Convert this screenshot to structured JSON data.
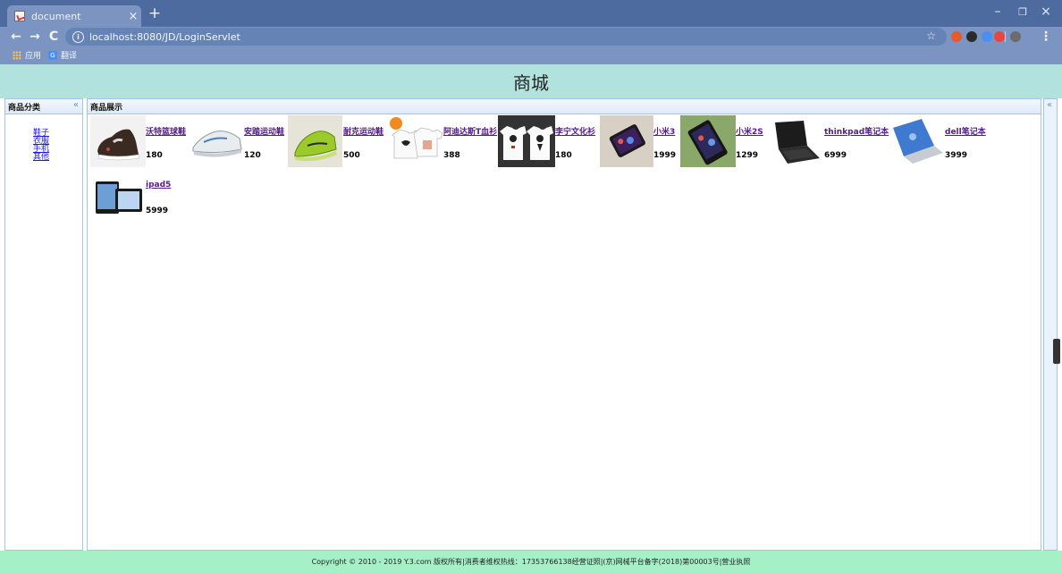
{
  "browser": {
    "tab_title": "document",
    "tab_close": "×",
    "new_tab": "+",
    "url": "localhost:8080/JD/LoginServlet",
    "back": "←",
    "forward": "→",
    "reload": "C",
    "info": "i",
    "star": "☆",
    "menu": "⋮",
    "minimize": "–",
    "maximize": "❐",
    "close": "×",
    "bookmarks": [
      "应用",
      "翻译"
    ],
    "extension_colors": [
      "#e85a2c",
      "#2b2b2b",
      "#4b8ef2",
      "#e9463f",
      "#6b6b6b"
    ]
  },
  "page": {
    "title": "商城",
    "west": {
      "title": "商品分类",
      "collapse": "«",
      "categories": [
        "鞋子",
        "衣服",
        "手机",
        "其他"
      ]
    },
    "center": {
      "title": "商品展示"
    },
    "east_collapse": "«",
    "products": [
      {
        "name": "沃特篮球鞋",
        "price": "180"
      },
      {
        "name": "安踏运动鞋",
        "price": "120"
      },
      {
        "name": "耐克运动鞋",
        "price": "500"
      },
      {
        "name": "阿迪达斯T血衫",
        "price": "388"
      },
      {
        "name": "李宁文化衫",
        "price": "180"
      },
      {
        "name": "小米3",
        "price": "1999"
      },
      {
        "name": "小米2S",
        "price": "1299"
      },
      {
        "name": "thinkpad笔记本",
        "price": "6999"
      },
      {
        "name": "dell笔记本",
        "price": "3999"
      },
      {
        "name": "ipad5",
        "price": "5999"
      }
    ],
    "footer": "Copyright © 2010 - 2019 Y.3.com 版权所有|消费者维权热线：17353766138经营证照|(京)网械平台备字(2018)第00003号|营业执照",
    "colors": {
      "header": "#b2e2de",
      "footer": "#a6f0c8",
      "panel_border": "#9fc5e8",
      "link_visited": "#551a8b",
      "link": "#1a1ae6"
    }
  }
}
